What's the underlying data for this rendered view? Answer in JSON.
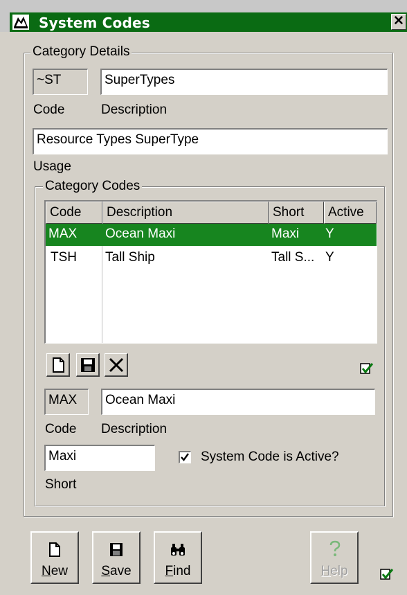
{
  "window": {
    "title": "System Codes",
    "close_glyph": "✕"
  },
  "category_details": {
    "group_label": "Category Details",
    "code_value": "~ST",
    "code_label": "Code",
    "description_value": "SuperTypes",
    "description_label": "Description",
    "usage_value": "Resource Types SuperType",
    "usage_label": "Usage"
  },
  "category_codes": {
    "group_label": "Category Codes",
    "columns": [
      "Code",
      "Description",
      "Short",
      "Active"
    ],
    "rows": [
      {
        "code": "MAX",
        "description": "Ocean Maxi",
        "short": "Maxi",
        "active": "Y",
        "selected": true
      },
      {
        "code": "TSH",
        "description": "Tall Ship",
        "short": "Tall S...",
        "active": "Y",
        "selected": false
      }
    ],
    "toolbar_icons": [
      "new-document-icon",
      "save-disk-icon",
      "delete-x-icon"
    ],
    "status_icon": "check-edit-icon",
    "detail": {
      "code_value": "MAX",
      "code_label": "Code",
      "description_value": "Ocean Maxi",
      "description_label": "Description",
      "short_value": "Maxi",
      "short_label": "Short",
      "active_label": "System Code is Active?",
      "active_checked": true
    }
  },
  "buttons": {
    "new_label": "New",
    "new_underline": "N",
    "new_rest": "ew",
    "save_label": "Save",
    "save_underline": "S",
    "save_rest": "ave",
    "find_label": "Find",
    "find_underline": "F",
    "find_rest": "ind",
    "help_label": "Help",
    "help_underline": "H",
    "help_rest": "elp",
    "help_enabled": false
  },
  "colors": {
    "titlebar": "#0a6b13",
    "selection": "#17851f",
    "face": "#d4d0c8"
  }
}
